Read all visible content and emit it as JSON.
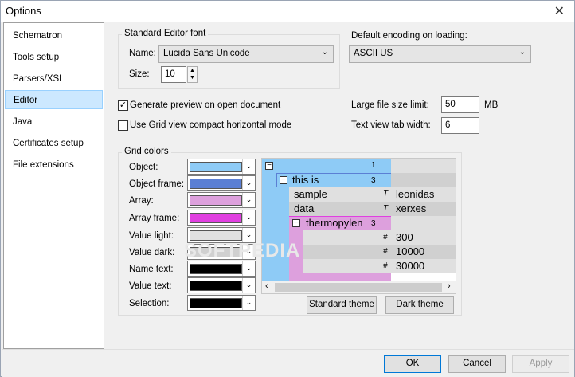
{
  "window": {
    "title": "Options"
  },
  "sidebar": {
    "items": [
      {
        "label": "Schematron"
      },
      {
        "label": "Tools setup"
      },
      {
        "label": "Parsers/XSL"
      },
      {
        "label": "Editor"
      },
      {
        "label": "Java"
      },
      {
        "label": "Certificates setup"
      },
      {
        "label": "File extensions"
      }
    ],
    "selected": "Editor"
  },
  "font_group": {
    "title": "Standard Editor font",
    "name_label": "Name:",
    "name_value": "Lucida Sans Unicode",
    "size_label": "Size:",
    "size_value": "10"
  },
  "encoding": {
    "label": "Default encoding on loading:",
    "value": "ASCII US"
  },
  "options": {
    "preview_label": "Generate preview on open document",
    "preview_checked": true,
    "compact_label": "Use Grid view compact horizontal mode",
    "compact_checked": false
  },
  "large_file": {
    "label": "Large file size limit:",
    "value": "50",
    "unit": "MB"
  },
  "tab_width": {
    "label": "Text view tab width:",
    "value": "6"
  },
  "grid_colors": {
    "title": "Grid colors",
    "items": [
      {
        "label": "Object:",
        "color": "#8ecbf6"
      },
      {
        "label": "Object frame:",
        "color": "#5b7fd4"
      },
      {
        "label": "Array:",
        "color": "#dda0dd"
      },
      {
        "label": "Array frame:",
        "color": "#e040e0"
      },
      {
        "label": "Value light:",
        "color": "#e0e0e0"
      },
      {
        "label": "Value dark:",
        "color": "#d0d0d0"
      },
      {
        "label": "Name text:",
        "color": "#000000"
      },
      {
        "label": "Value text:",
        "color": "#000000"
      },
      {
        "label": "Selection:",
        "color": "#000000"
      }
    ]
  },
  "preview": {
    "root_count": "1",
    "this_is": "this is",
    "this_is_count": "3",
    "rows": [
      {
        "name": "sample",
        "type": "T",
        "value": "leonidas"
      },
      {
        "name": "data",
        "type": "T",
        "value": "xerxes"
      }
    ],
    "array_name": "thermopylen",
    "array_count": "3",
    "array_values": [
      {
        "type": "#",
        "value": "300"
      },
      {
        "type": "#",
        "value": "10000"
      },
      {
        "type": "#",
        "value": "30000"
      }
    ]
  },
  "theme_buttons": {
    "standard": "Standard theme",
    "dark": "Dark theme"
  },
  "footer": {
    "ok": "OK",
    "cancel": "Cancel",
    "apply": "Apply"
  },
  "watermark": "SOFTPEDIA"
}
